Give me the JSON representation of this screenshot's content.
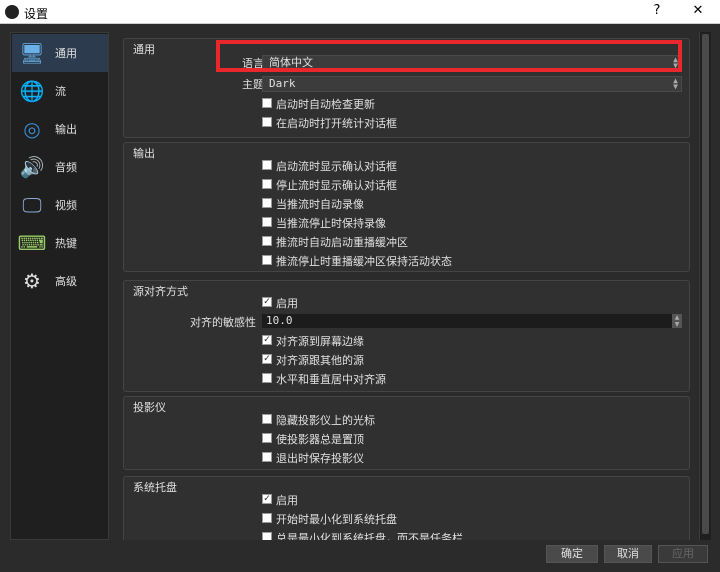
{
  "window": {
    "title": "设置",
    "help": "?",
    "close": "✕"
  },
  "sidebar": {
    "items": [
      {
        "label": "通用",
        "icon": "general-icon",
        "selected": true
      },
      {
        "label": "流",
        "icon": "stream-globe-icon"
      },
      {
        "label": "输出",
        "icon": "output-signal-icon"
      },
      {
        "label": "音频",
        "icon": "audio-speaker-icon"
      },
      {
        "label": "视频",
        "icon": "video-monitor-icon"
      },
      {
        "label": "热键",
        "icon": "hotkeys-keyboard-icon"
      },
      {
        "label": "高级",
        "icon": "advanced-gears-icon"
      }
    ]
  },
  "general": {
    "title": "通用",
    "language_label": "语言",
    "language_value": "简体中文",
    "theme_label": "主题",
    "theme_value": "Dark",
    "checks": [
      {
        "label": "启动时自动检查更新",
        "checked": false
      },
      {
        "label": "在启动时打开统计对话框",
        "checked": false
      }
    ]
  },
  "output": {
    "title": "输出",
    "checks": [
      {
        "label": "启动流时显示确认对话框",
        "checked": false
      },
      {
        "label": "停止流时显示确认对话框",
        "checked": false
      },
      {
        "label": "当推流时自动录像",
        "checked": false
      },
      {
        "label": "当推流停止时保持录像",
        "checked": false
      },
      {
        "label": "推流时自动启动重播缓冲区",
        "checked": false
      },
      {
        "label": "推流停止时重播缓冲区保持活动状态",
        "checked": false
      }
    ]
  },
  "snapping": {
    "title": "源对齐方式",
    "enable": {
      "label": "启用",
      "checked": true
    },
    "sensitivity_label": "对齐的敏感性",
    "sensitivity_value": "10.0",
    "checks": [
      {
        "label": "对齐源到屏幕边缘",
        "checked": true
      },
      {
        "label": "对齐源跟其他的源",
        "checked": true
      },
      {
        "label": "水平和垂直居中对齐源",
        "checked": false
      }
    ]
  },
  "projector": {
    "title": "投影仪",
    "checks": [
      {
        "label": "隐藏投影仪上的光标",
        "checked": false
      },
      {
        "label": "使投影器总是置顶",
        "checked": false
      },
      {
        "label": "退出时保存投影仪",
        "checked": false
      }
    ]
  },
  "tray": {
    "title": "系统托盘",
    "checks": [
      {
        "label": "启用",
        "checked": true
      },
      {
        "label": "开始时最小化到系统托盘",
        "checked": false
      },
      {
        "label": "总是最小化到系统托盘，而不是任务栏",
        "checked": false
      }
    ]
  },
  "buttons": {
    "ok": "确定",
    "cancel": "取消",
    "apply": "应用"
  },
  "colors": {
    "highlight": "#e8282c",
    "selected": "#2c3b4d"
  }
}
